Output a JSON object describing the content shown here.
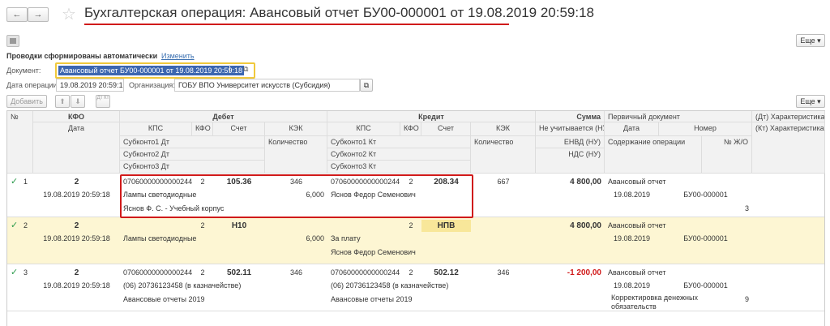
{
  "header": {
    "back_icon": "←",
    "forward_icon": "→",
    "star_icon": "☆",
    "title": "Бухгалтерская операция: Авансовый отчет БУ00-000001 от 19.08.2019 20:59:18",
    "more": "Еще",
    "more2": "Еще"
  },
  "form": {
    "auto_label": "Проводки сформированы автоматически",
    "change_link": "Изменить",
    "document_label": "Документ:",
    "document_value": "Авансовый отчет БУ00-000001 от 19.08.2019 20:59:18",
    "dots": "...",
    "date_label": "Дата операции:",
    "date_value": "19.08.2019 20:59:18",
    "org_label": "Организация:",
    "org_value": "ГОБУ ВПО Университет искусств (Субсидия)"
  },
  "toolbar": {
    "add": "Добавить",
    "up": "⬆",
    "down": "⬇",
    "sort": "Дт Кт"
  },
  "columns": {
    "num": "№",
    "kfo": "КФО",
    "date": "Дата",
    "debit": "Дебет",
    "credit": "Кредит",
    "kps": "КПС",
    "kfo_sub": "КФО",
    "schet": "Счет",
    "kek": "КЭК",
    "qty": "Количество",
    "dt_sub1": "Субконто1 Дт",
    "dt_sub2": "Субконто2 Дт",
    "dt_sub3": "Субконто3 Дт",
    "kt_sub1": "Субконто1 Кт",
    "kt_sub2": "Субконто2 Кт",
    "kt_sub3": "Субконто3 Кт",
    "sum": "Сумма",
    "nu1": "Не учитывается (НУ)",
    "nu2": "ЕНВД (НУ)",
    "nu3": "НДС (НУ)",
    "primary": "Первичный документ",
    "pdate": "Дата",
    "pnum": "Номер",
    "content": "Содержание операции",
    "jo": "№ Ж/О",
    "dt_char": "(Дт) Характеристика ...",
    "kt_char": "(Кт) Характеристика движения"
  },
  "rows": [
    {
      "check": "✓",
      "n": "1",
      "kfo": "2",
      "date": "19.08.2019 20:59:18",
      "dt_kps": "07060000000000244",
      "dt_kfo": "2",
      "dt_schet": "105.36",
      "dt_kek": "346",
      "dt_sub1": "Лампы светодиодные",
      "dt_qty": "6,000",
      "dt_sub2": "Яснов Ф. С. - Учебный корпус",
      "kt_kps": "07060000000000244",
      "kt_kfo": "2",
      "kt_schet": "208.34",
      "kt_kek": "667",
      "kt_sub1": "Яснов Федор Семенович",
      "kt_sub2": "",
      "sum": "4 800,00",
      "doc": "Авансовый отчет",
      "doc_date": "19.08.2019",
      "doc_num": "БУ00-000001",
      "content": "",
      "jo": "3"
    },
    {
      "check": "✓",
      "n": "2",
      "kfo": "2",
      "date": "19.08.2019 20:59:18",
      "dt_kps": "",
      "dt_kfo": "2",
      "dt_schet": "Н10",
      "dt_kek": "",
      "dt_sub1": "Лампы светодиодные",
      "dt_qty": "6,000",
      "dt_sub2": "",
      "kt_kps": "",
      "kt_kfo": "2",
      "kt_schet": "НПВ",
      "kt_kek": "",
      "kt_sub1": "За плату",
      "kt_sub2": "Яснов Федор Семенович",
      "sum": "4 800,00",
      "doc": "Авансовый отчет",
      "doc_date": "19.08.2019",
      "doc_num": "БУ00-000001",
      "content": "",
      "jo": ""
    },
    {
      "check": "✓",
      "n": "3",
      "kfo": "2",
      "date": "19.08.2019 20:59:18",
      "dt_kps": "07060000000000244",
      "dt_kfo": "2",
      "dt_schet": "502.11",
      "dt_kek": "346",
      "dt_sub1": "(06) 20736123458 (в казначействе)",
      "dt_qty": "",
      "dt_sub2": "Авансовые отчеты 2019",
      "kt_kps": "07060000000000244",
      "kt_kfo": "2",
      "kt_schet": "502.12",
      "kt_kek": "346",
      "kt_sub1": "(06) 20736123458 (в казначействе)",
      "kt_sub2": "Авансовые отчеты 2019",
      "sum": "-1 200,00",
      "doc": "Авансовый отчет",
      "doc_date": "19.08.2019",
      "doc_num": "БУ00-000001",
      "content": "Корректировка денежных обязательств",
      "jo": "9"
    }
  ],
  "colors": {
    "highlight": "#fdf6d3",
    "accent": "#d01a1a",
    "check": "#2a9a4a",
    "negative": "#d01a1a"
  }
}
